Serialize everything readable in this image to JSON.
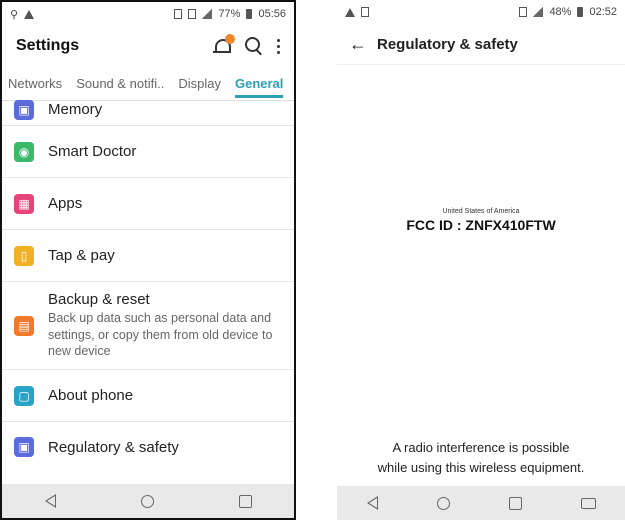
{
  "left_phone": {
    "status": {
      "battery": "77%",
      "time": "05:56"
    },
    "header": {
      "title": "Settings"
    },
    "tabs": [
      {
        "label": "Networks"
      },
      {
        "label": "Sound & notifi.."
      },
      {
        "label": "Display"
      },
      {
        "label": "General",
        "active": true
      }
    ],
    "items": [
      {
        "label": "Memory",
        "icon": "memory-icon",
        "color": "#5b6bdc"
      },
      {
        "label": "Smart Doctor",
        "icon": "smart-doctor-icon",
        "color": "#3cb86a"
      },
      {
        "label": "Apps",
        "icon": "apps-icon",
        "color": "#e5457a"
      },
      {
        "label": "Tap & pay",
        "icon": "tap-pay-icon",
        "color": "#f2b024"
      },
      {
        "label": "Backup & reset",
        "description": "Back up data such as personal data and settings, or copy them from old device to new device",
        "icon": "backup-icon",
        "color": "#f07a2a"
      },
      {
        "label": "About phone",
        "icon": "about-phone-icon",
        "color": "#2aa3c8"
      },
      {
        "label": "Regulatory & safety",
        "icon": "regulatory-icon",
        "color": "#5b6bdc"
      }
    ]
  },
  "right_phone": {
    "status": {
      "battery": "48%",
      "time": "02:52"
    },
    "header": {
      "title": "Regulatory & safety"
    },
    "fcc": {
      "country": "United States of America",
      "id": "FCC ID : ZNFX410FTW"
    },
    "notice": {
      "line1": "A radio interference is possible",
      "line2": "while using this wireless equipment."
    }
  },
  "colors": {
    "accent": "#2b9fb3",
    "navbar": "#e9e9e9"
  }
}
